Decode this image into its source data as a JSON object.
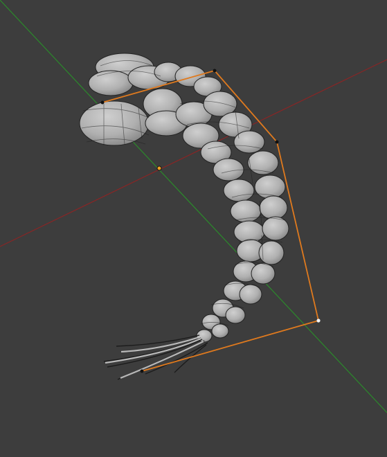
{
  "viewport": {
    "background": "#3d3d3d",
    "x_axis_color": "#8a2525",
    "y_axis_color": "#2b8a2b",
    "control_path_color": "#e07a1e",
    "mesh_fill": "#b8b8b8",
    "mesh_shade": "#8e8e8e",
    "mesh_wire": "#1e1e1e",
    "origin_color": "#f0a020"
  },
  "icons": {
    "origin": "origin-dot-icon",
    "control_point": "control-point-icon",
    "mesh": "braid-mesh"
  }
}
